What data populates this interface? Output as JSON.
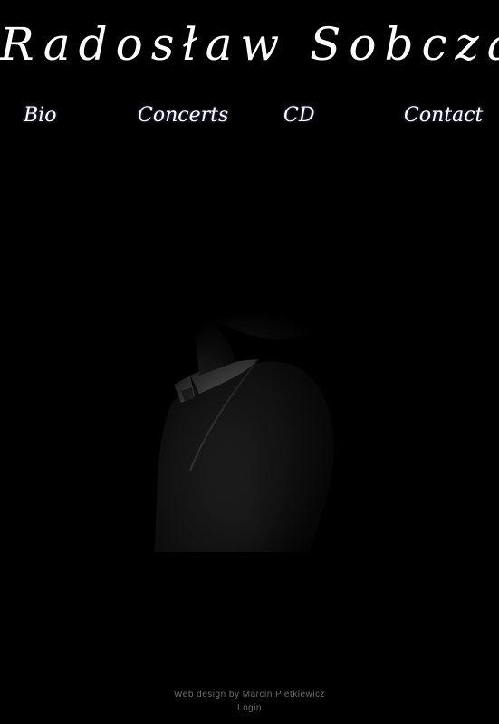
{
  "site": {
    "title": "Radosław Sobczak"
  },
  "nav": {
    "items": [
      {
        "label": "Bio"
      },
      {
        "label": "Concerts"
      },
      {
        "label": "CD"
      },
      {
        "label": "Contact"
      }
    ]
  },
  "photo": {
    "icon": "portrait-photo"
  },
  "footer": {
    "credit": "Web design by Marcin Pietkiewicz",
    "login": "Login"
  },
  "colors": {
    "background": "#000000",
    "text": "#ffffff",
    "footer_text": "#6e6e6e"
  }
}
